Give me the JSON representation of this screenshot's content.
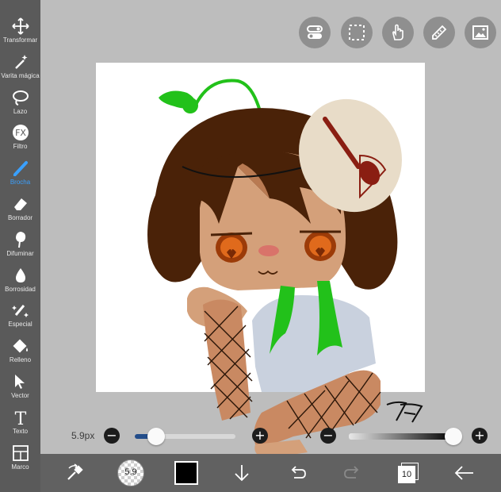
{
  "tools": [
    {
      "label": "Transformar",
      "icon": "move-icon"
    },
    {
      "label": "Varita mágica",
      "icon": "magic-wand-icon"
    },
    {
      "label": "Lazo",
      "icon": "lasso-icon"
    },
    {
      "label": "Filtro",
      "icon": "fx-icon",
      "glyph": "FX"
    },
    {
      "label": "Brocha",
      "icon": "brush-icon",
      "active": true
    },
    {
      "label": "Borrador",
      "icon": "eraser-icon"
    },
    {
      "label": "Difuminar",
      "icon": "smudge-icon"
    },
    {
      "label": "Borrosidad",
      "icon": "blur-drop-icon"
    },
    {
      "label": "Especial",
      "icon": "special-pen-icon"
    },
    {
      "label": "Relleno",
      "icon": "fill-bucket-icon"
    },
    {
      "label": "Vector",
      "icon": "cursor-arrow-icon"
    },
    {
      "label": "Texto",
      "icon": "text-icon",
      "glyph": "T"
    },
    {
      "label": "Marco",
      "icon": "frame-icon"
    }
  ],
  "top_buttons": [
    "toggle-icon",
    "selection-icon",
    "hand-icon",
    "ruler-pen-icon",
    "image-icon"
  ],
  "brush": {
    "size_label": "5.9px",
    "size_level": 0.12,
    "opacity_level": 1.0
  },
  "bottom": {
    "brush_size_badge": "5.9",
    "color": "#000000",
    "layers_count": "10"
  },
  "artwork": {
    "signature": "77"
  },
  "colors": {
    "accent": "#3aa0ff",
    "toolbar": "#5a5a5a",
    "canvas": "#ffffff",
    "hair": "#4a2208",
    "skin": "#d4a07a",
    "shirt": "#c9d1de",
    "green": "#22c11a",
    "beret": "#e8dcc8"
  }
}
